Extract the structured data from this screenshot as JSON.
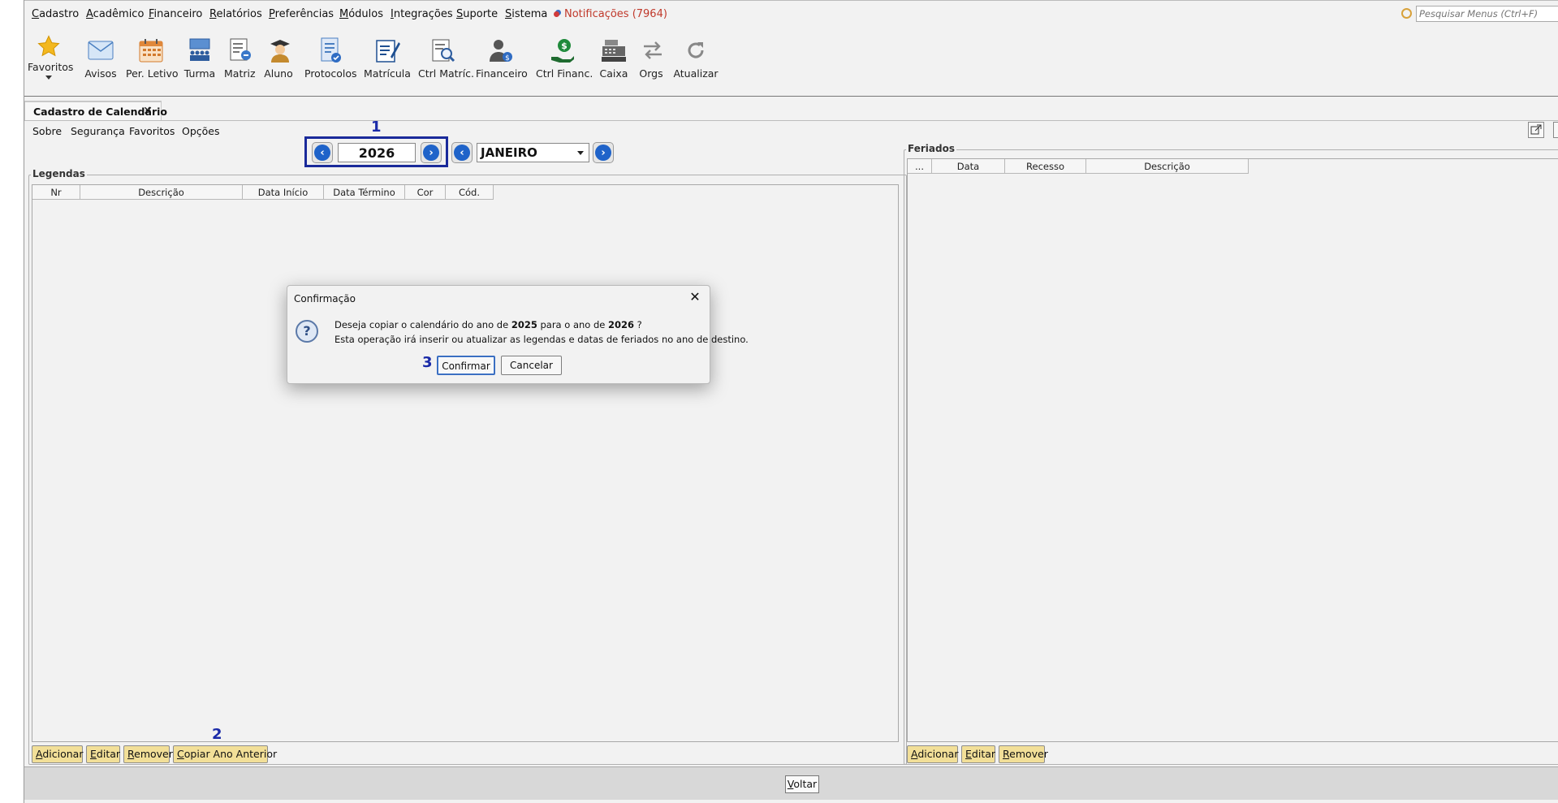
{
  "menubar": {
    "items": [
      "Cadastro",
      "Acadêmico",
      "Financeiro",
      "Relatórios",
      "Preferências",
      "Módulos",
      "Integrações",
      "Suporte",
      "Sistema"
    ],
    "notifications": "Notificações (7964)",
    "search_placeholder": "Pesquisar Menus (Ctrl+F)"
  },
  "toolbar": {
    "favoritos": "Favoritos",
    "avisos": "Avisos",
    "per_letivo": "Per. Letivo",
    "turma": "Turma",
    "matriz": "Matriz",
    "aluno": "Aluno",
    "protocolos": "Protocolos",
    "matricula": "Matrícula",
    "ctrl_matric": "Ctrl Matríc.",
    "financeiro": "Financeiro",
    "ctrl_financ": "Ctrl Financ.",
    "caixa": "Caixa",
    "orgs": "Orgs",
    "atualizar": "Atualizar"
  },
  "tab": {
    "title": "Cadastro de Calendário",
    "close": "✕"
  },
  "submenu": {
    "items": [
      "Sobre",
      "Segurança",
      "Favoritos",
      "Opções"
    ]
  },
  "navigator": {
    "year": "2026",
    "month": "JANEIRO"
  },
  "annotations": {
    "a1": "1",
    "a2": "2",
    "a3": "3"
  },
  "legendas": {
    "title": "Legendas",
    "columns": [
      "Nr",
      "Descrição",
      "Data Início",
      "Data Término",
      "Cor",
      "Cód."
    ],
    "buttons": {
      "adicionar": "Adicionar",
      "editar": "Editar",
      "remover": "Remover",
      "copiar": "Copiar Ano Anterior"
    }
  },
  "feriados": {
    "title": "Feriados",
    "columns": [
      "...",
      "Data",
      "Recesso",
      "Descrição"
    ],
    "buttons": {
      "adicionar": "Adicionar",
      "editar": "Editar",
      "remover": "Remover"
    }
  },
  "footer": {
    "voltar": "Voltar"
  },
  "dialog": {
    "title": "Confirmação",
    "line1_a": "Deseja copiar o calendário do ano de ",
    "year_from": "2025",
    "line1_b": " para o ano de ",
    "year_to": "2026",
    "line1_c": " ?",
    "line2": "Esta operação irá inserir ou atualizar as legendas e datas de feriados no ano de destino.",
    "confirm": "Confirmar",
    "cancel": "Cancelar"
  },
  "colors": {
    "annotation": "#1a2aa8",
    "button_yellow": "#f2df98",
    "notification": "#c0392b",
    "nav_blue": "#1f63c9"
  }
}
